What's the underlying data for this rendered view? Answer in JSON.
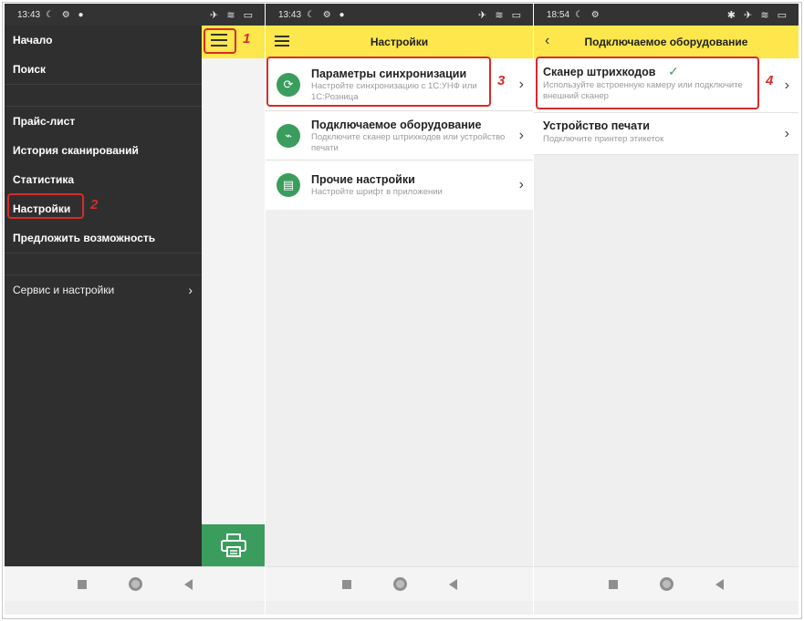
{
  "phones": [
    {
      "status_time": "13:43",
      "drawer": {
        "group1": [
          "Начало",
          "Поиск"
        ],
        "group2": [
          "Прайс-лист",
          "История сканирований",
          "Статистика",
          "Настройки",
          "Предложить возможность"
        ],
        "service_label": "Сервис и настройки"
      },
      "callouts": {
        "menu": "1",
        "settings": "2"
      }
    },
    {
      "status_time": "13:43",
      "title": "Настройки",
      "items": [
        {
          "title": "Параметры синхронизации",
          "subtitle": "Настройте синхронизацию с 1С:УНФ или 1С:Розница",
          "icon": "sync-icon"
        },
        {
          "title": "Подключаемое оборудование",
          "subtitle": "Подключите сканер штрихкодов или устройство печати",
          "icon": "scanner-icon"
        },
        {
          "title": "Прочие настройки",
          "subtitle": "Настройте шрифт в приложении",
          "icon": "settings-doc-icon"
        }
      ],
      "callout": "3"
    },
    {
      "status_time": "18:54",
      "title": "Подключаемое оборудование",
      "items": [
        {
          "title": "Сканер штрихкодов",
          "subtitle": "Используйте встроенную камеру или подключите внешний сканер",
          "checked": true
        },
        {
          "title": "Устройство печати",
          "subtitle": "Подключите принтер этикеток"
        }
      ],
      "callout": "4"
    }
  ],
  "colors": {
    "accent_yellow": "#fde74c",
    "green": "#3a9d5d",
    "highlight_red": "#d62b2b",
    "drawer_dark": "#2f2f2f"
  }
}
